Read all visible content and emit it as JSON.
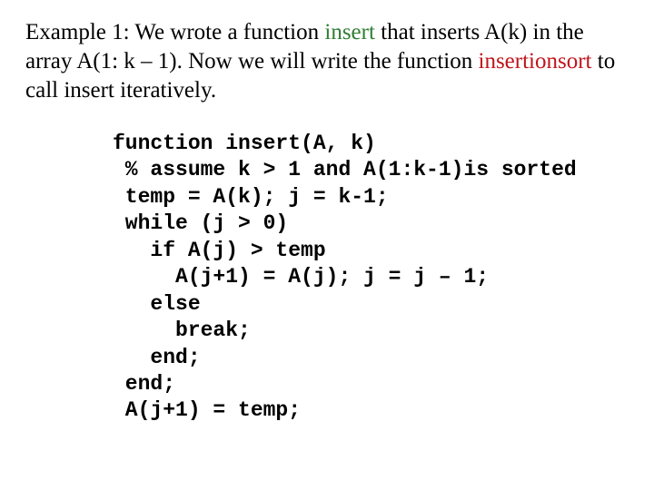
{
  "intro": {
    "seg1": "Example 1: We wrote a function ",
    "insert_kw": "insert",
    "seg2": " that inserts A(k) in the array A(1: k – 1). Now we will write the function ",
    "insertionsort_kw": "insertionsort",
    "seg3": " to call insert iteratively."
  },
  "code": {
    "l1": "function insert(A, k)",
    "l2": " % assume k > 1 and A(1:k-1)is sorted",
    "l3": " temp = A(k); j = k-1;",
    "l4": " while (j > 0)",
    "l5": "   if A(j) > temp",
    "l6": "     A(j+1) = A(j); j = j – 1;",
    "l7": "   else",
    "l8": "     break;",
    "l9": "   end;",
    "l10": " end;",
    "l11": " A(j+1) = temp;"
  }
}
